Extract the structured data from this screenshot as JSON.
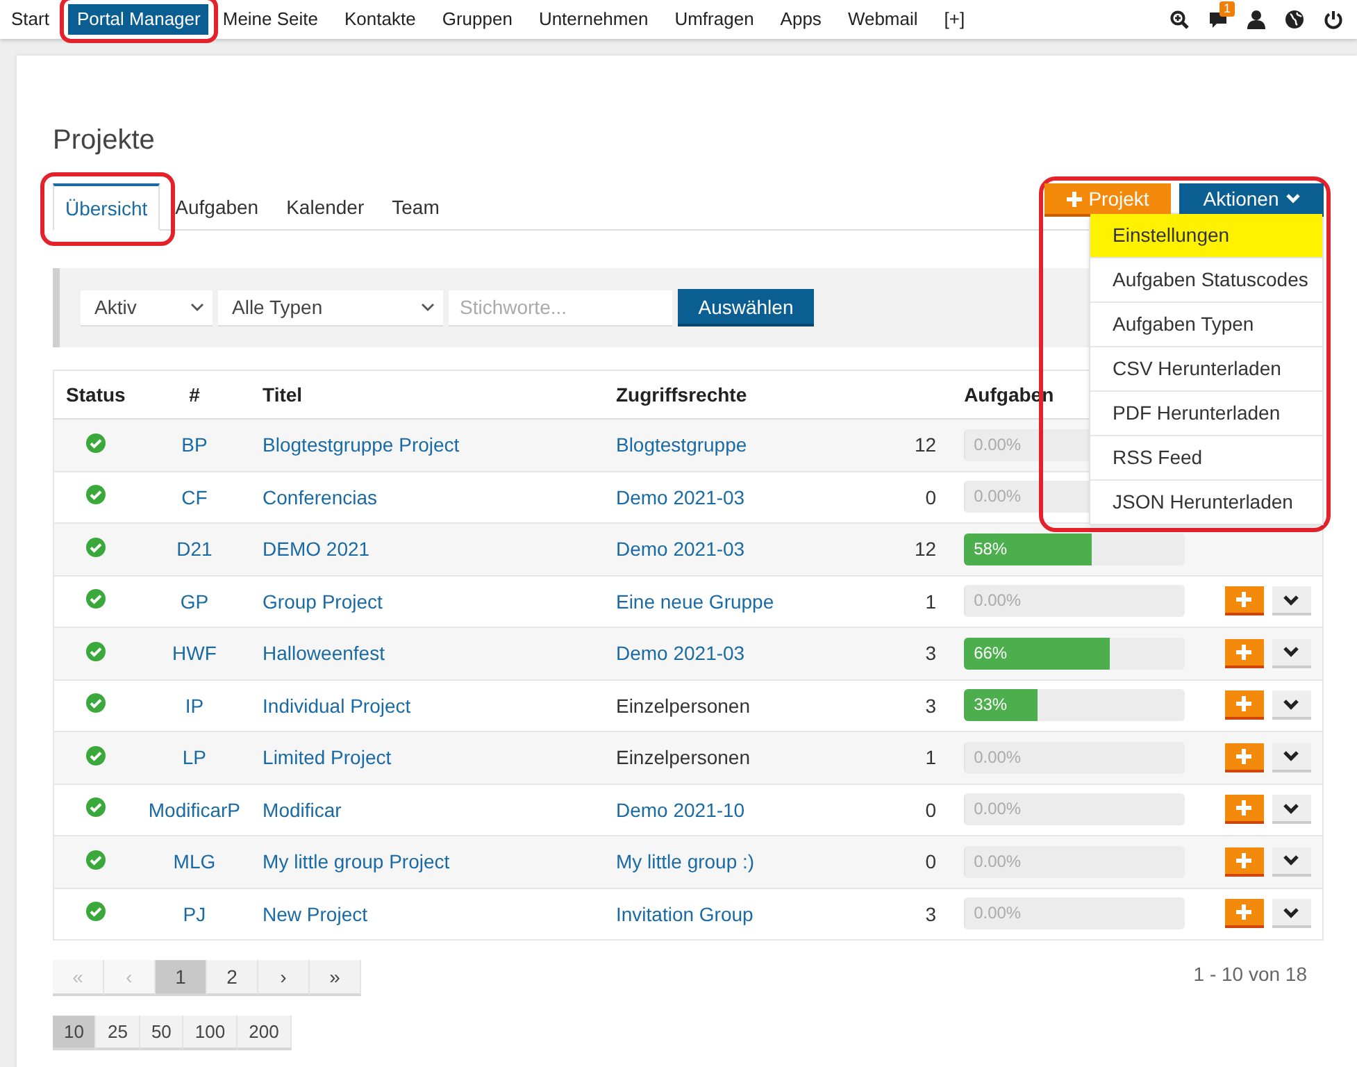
{
  "nav": {
    "items": [
      {
        "label": "Start",
        "selected": false,
        "highlighted": false
      },
      {
        "label": "Portal Manager",
        "selected": true,
        "highlighted": true
      },
      {
        "label": "Meine Seite",
        "selected": false,
        "highlighted": false
      },
      {
        "label": "Kontakte",
        "selected": false,
        "highlighted": false
      },
      {
        "label": "Gruppen",
        "selected": false,
        "highlighted": false
      },
      {
        "label": "Unternehmen",
        "selected": false,
        "highlighted": false
      },
      {
        "label": "Umfragen",
        "selected": false,
        "highlighted": false
      },
      {
        "label": "Apps",
        "selected": false,
        "highlighted": false
      },
      {
        "label": "Webmail",
        "selected": false,
        "highlighted": false
      },
      {
        "label": "[+]",
        "selected": false,
        "highlighted": false
      }
    ],
    "icons": [
      {
        "kind": "search"
      },
      {
        "kind": "chat",
        "badge": "1"
      },
      {
        "kind": "user"
      },
      {
        "kind": "globe"
      },
      {
        "kind": "power"
      }
    ]
  },
  "page_title": "Projekte",
  "tabs": [
    {
      "label": "Übersicht",
      "selected": true,
      "highlighted": true
    },
    {
      "label": "Aufgaben",
      "selected": false,
      "highlighted": false
    },
    {
      "label": "Kalender",
      "selected": false,
      "highlighted": false
    },
    {
      "label": "Team",
      "selected": false,
      "highlighted": false
    }
  ],
  "actions": {
    "new_button": "Projekt",
    "menu_button": "Aktionen",
    "highlighted": true,
    "menu": [
      {
        "label": "Einstellungen",
        "selected": true
      },
      {
        "label": "Aufgaben Statuscodes",
        "selected": false
      },
      {
        "label": "Aufgaben Typen",
        "selected": false
      },
      {
        "label": "CSV Herunterladen",
        "selected": false
      },
      {
        "label": "PDF Herunterladen",
        "selected": false
      },
      {
        "label": "RSS Feed",
        "selected": false
      },
      {
        "label": "JSON Herunterladen",
        "selected": false
      }
    ]
  },
  "filter": {
    "status": "Aktiv",
    "type": "Alle Typen",
    "placeholder": "Stichworte...",
    "button": "Auswählen"
  },
  "table": {
    "columns": [
      "Status",
      "#",
      "Titel",
      "Zugriffsrechte",
      "Aufgaben"
    ],
    "rows": [
      {
        "code": "BP",
        "title": "Blogtestgruppe Project",
        "access": "Blogtestgruppe",
        "access_link": true,
        "count": "12",
        "progress": "0.00%",
        "level": 0,
        "actions_visible": false
      },
      {
        "code": "CF",
        "title": "Conferencias",
        "access": "Demo 2021-03",
        "access_link": true,
        "count": "0",
        "progress": "0.00%",
        "level": 0,
        "actions_visible": false
      },
      {
        "code": "D21",
        "title": "DEMO 2021",
        "access": "Demo 2021-03",
        "access_link": true,
        "count": "12",
        "progress": "58%",
        "level": 0.58,
        "actions_visible": false
      },
      {
        "code": "GP",
        "title": "Group Project",
        "access": "Eine neue Gruppe",
        "access_link": true,
        "count": "1",
        "progress": "0.00%",
        "level": 0,
        "actions_visible": true
      },
      {
        "code": "HWF",
        "title": "Halloweenfest",
        "access": "Demo 2021-03",
        "access_link": true,
        "count": "3",
        "progress": "66%",
        "level": 0.66,
        "actions_visible": true
      },
      {
        "code": "IP",
        "title": "Individual Project",
        "access": "Einzelpersonen",
        "access_link": false,
        "count": "3",
        "progress": "33%",
        "level": 0.33,
        "actions_visible": true
      },
      {
        "code": "LP",
        "title": "Limited Project",
        "access": "Einzelpersonen",
        "access_link": false,
        "count": "1",
        "progress": "0.00%",
        "level": 0,
        "actions_visible": true
      },
      {
        "code": "ModificarP",
        "title": "Modificar",
        "access": "Demo 2021-10",
        "access_link": true,
        "count": "0",
        "progress": "0.00%",
        "level": 0,
        "actions_visible": true
      },
      {
        "code": "MLG",
        "title": "My little group Project",
        "access": "My little group :)",
        "access_link": true,
        "count": "0",
        "progress": "0.00%",
        "level": 0,
        "actions_visible": true
      },
      {
        "code": "PJ",
        "title": "New Project",
        "access": "Invitation Group",
        "access_link": true,
        "count": "3",
        "progress": "0.00%",
        "level": 0,
        "actions_visible": true
      }
    ]
  },
  "pagination": {
    "pages": [
      {
        "label": "«",
        "selected": false,
        "disabled": true
      },
      {
        "label": "‹",
        "selected": false,
        "disabled": true
      },
      {
        "label": "1",
        "selected": true,
        "disabled": false
      },
      {
        "label": "2",
        "selected": false,
        "disabled": false
      },
      {
        "label": "›",
        "selected": false,
        "disabled": false
      },
      {
        "label": "»",
        "selected": false,
        "disabled": false
      }
    ],
    "summary": "1 - 10 von 18",
    "page_sizes": [
      {
        "label": "10",
        "selected": true
      },
      {
        "label": "25",
        "selected": false
      },
      {
        "label": "50",
        "selected": false
      },
      {
        "label": "100",
        "selected": false
      },
      {
        "label": "200",
        "selected": false
      }
    ]
  }
}
